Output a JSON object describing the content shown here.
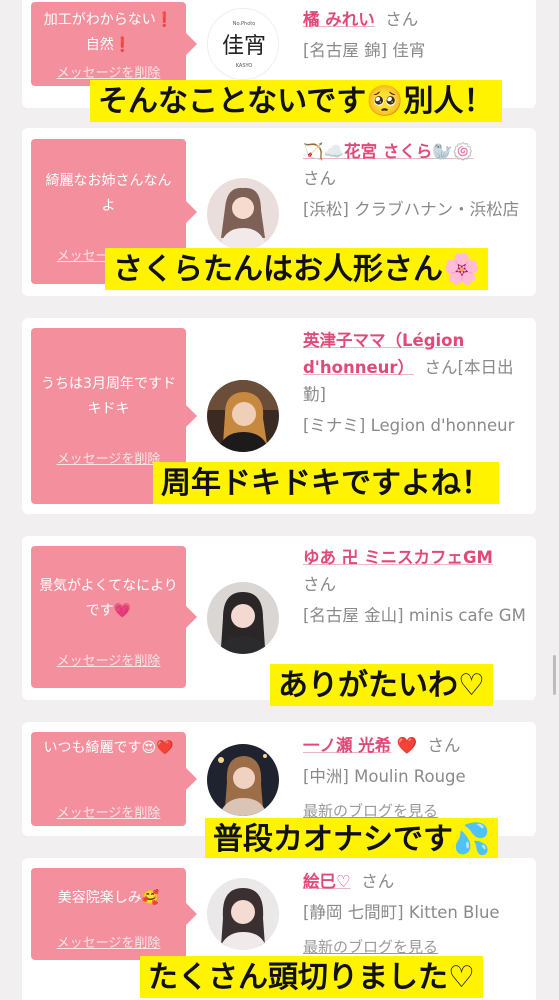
{
  "scroll": {
    "position": 0.68
  },
  "cards": [
    {
      "message": "加工がわからない❗自然❗",
      "delete_label": "メッセージを削除",
      "name": "橘 みれい",
      "honorific": "さん",
      "shop": "[名古屋 錦] 佳宵",
      "blog_link": "",
      "avatar_icon": "logo-avatar",
      "avatar_logo_text": "佳宵",
      "avatar_logo_top": "No.Photo",
      "avatar_logo_bottom": "KASYO",
      "caption": "そんなことないです🥺別人！"
    },
    {
      "message": "綺麗なお姉さんなんよ",
      "delete_label": "メッセージを削除",
      "name": "🏹☁️花宮 さくら🦭🍥",
      "honorific": "さん",
      "shop": "[浜松] クラブハナン・浜松店",
      "blog_link": "",
      "avatar_icon": "person-avatar",
      "caption": "さくらたんはお人形さん🌸"
    },
    {
      "message": "うちは3月周年ですドキドキ",
      "delete_label": "メッセージを削除",
      "name": "英津子ママ（Légion d'honneur）",
      "honorific": "さん[本日出勤]",
      "shop": "[ミナミ] Legion d'honneur",
      "blog_link": "",
      "avatar_icon": "person-avatar",
      "caption": "周年ドキドキですよね！"
    },
    {
      "message": "景気がよくてなによりです💗",
      "delete_label": "メッセージを削除",
      "name": "ゆあ 卍 ミニスカフェGM",
      "honorific": "さん",
      "shop": "[名古屋 金山] minis cafe GM",
      "blog_link": "",
      "avatar_icon": "person-avatar",
      "caption": "ありがたいわ♡"
    },
    {
      "message": "いつも綺麗です😍❤️",
      "delete_label": "メッセージを削除",
      "name": "一ノ瀬 光希",
      "name_heart": "❤️",
      "honorific": "さん",
      "shop": "[中洲] Moulin Rouge",
      "blog_link": "最新のブログを見る",
      "avatar_icon": "person-avatar",
      "caption": "普段カオナシです💦"
    },
    {
      "message": "美容院楽しみ🥰",
      "delete_label": "メッセージを削除",
      "name": "絵巳♡",
      "honorific": "さん",
      "shop": "[静岡 七間町] Kitten Blue",
      "blog_link": "最新のブログを見る",
      "avatar_icon": "person-avatar",
      "caption": "たくさん頭切りました♡"
    }
  ],
  "colors": {
    "bubble": "#f4909d",
    "name": "#e04a78",
    "caption_bg": "#fff300",
    "background": "#f1efef"
  }
}
